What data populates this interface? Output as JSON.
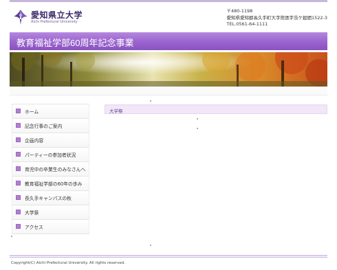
{
  "header": {
    "logo_jp": "愛知県立大学",
    "logo_en": "Aichi Prefectural University",
    "address_lines": [
      "〒480-1198",
      "愛知県愛知郡長久手町大字熊張字茨ケ廻間1522-3",
      "TEL.0561-64-1111"
    ]
  },
  "title_bar": {
    "text": "教育福祉学部60周年記念事業"
  },
  "sidebar": {
    "items": [
      {
        "label": "ホーム"
      },
      {
        "label": "記念行事のご案内"
      },
      {
        "label": "企画内容"
      },
      {
        "label": "パーティーの参加者状況"
      },
      {
        "label": "育児中の卒業生のみなさんへ"
      },
      {
        "label": "教育福祉学部の60年の歩み"
      },
      {
        "label": "長久手キャンパスの秋"
      },
      {
        "label": "大学祭"
      },
      {
        "label": "アクセス"
      }
    ]
  },
  "main": {
    "breadcrumb": "大学祭"
  },
  "footer": {
    "copyright": "Copyright(C) Aichi Prefectural University. All rights reserved."
  },
  "colors": {
    "accent": "#9a63cd",
    "nav_marker": "#b27ed2",
    "crumb_bg": "#f2e6f8"
  }
}
